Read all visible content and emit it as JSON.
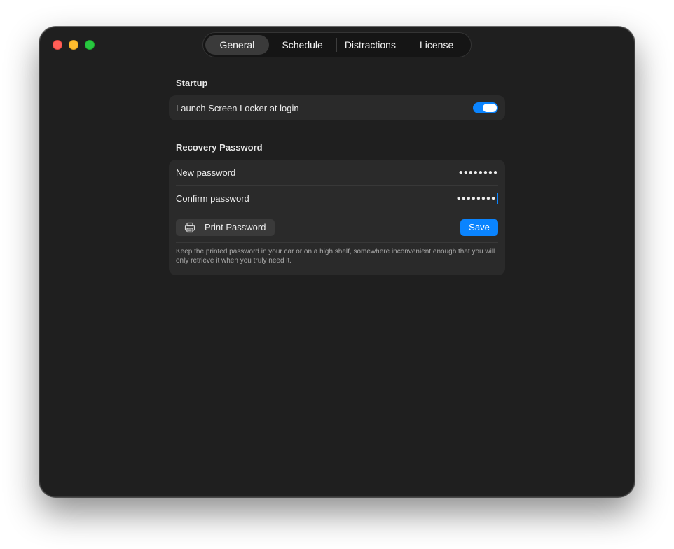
{
  "window": {
    "traffic_lights": [
      "close",
      "minimize",
      "zoom"
    ]
  },
  "tabs": [
    {
      "label": "General",
      "active": true
    },
    {
      "label": "Schedule",
      "active": false
    },
    {
      "label": "Distractions",
      "active": false
    },
    {
      "label": "License",
      "active": false
    }
  ],
  "startup": {
    "title": "Startup",
    "launch_label": "Launch Screen Locker at login",
    "launch_enabled": true
  },
  "recovery": {
    "title": "Recovery Password",
    "new_password_label": "New password",
    "new_password_value": "●●●●●●●●",
    "confirm_password_label": "Confirm password",
    "confirm_password_value": "●●●●●●●●",
    "print_label": "Print Password",
    "print_icon": "printer-icon",
    "save_label": "Save",
    "note": "Keep the printed password in your car or on a high shelf, somewhere inconvenient enough that you will only retrieve it when you truly need it."
  },
  "colors": {
    "accent": "#0a84ff",
    "window_bg": "#1f1f1f",
    "card_bg": "#2a2a2a"
  }
}
